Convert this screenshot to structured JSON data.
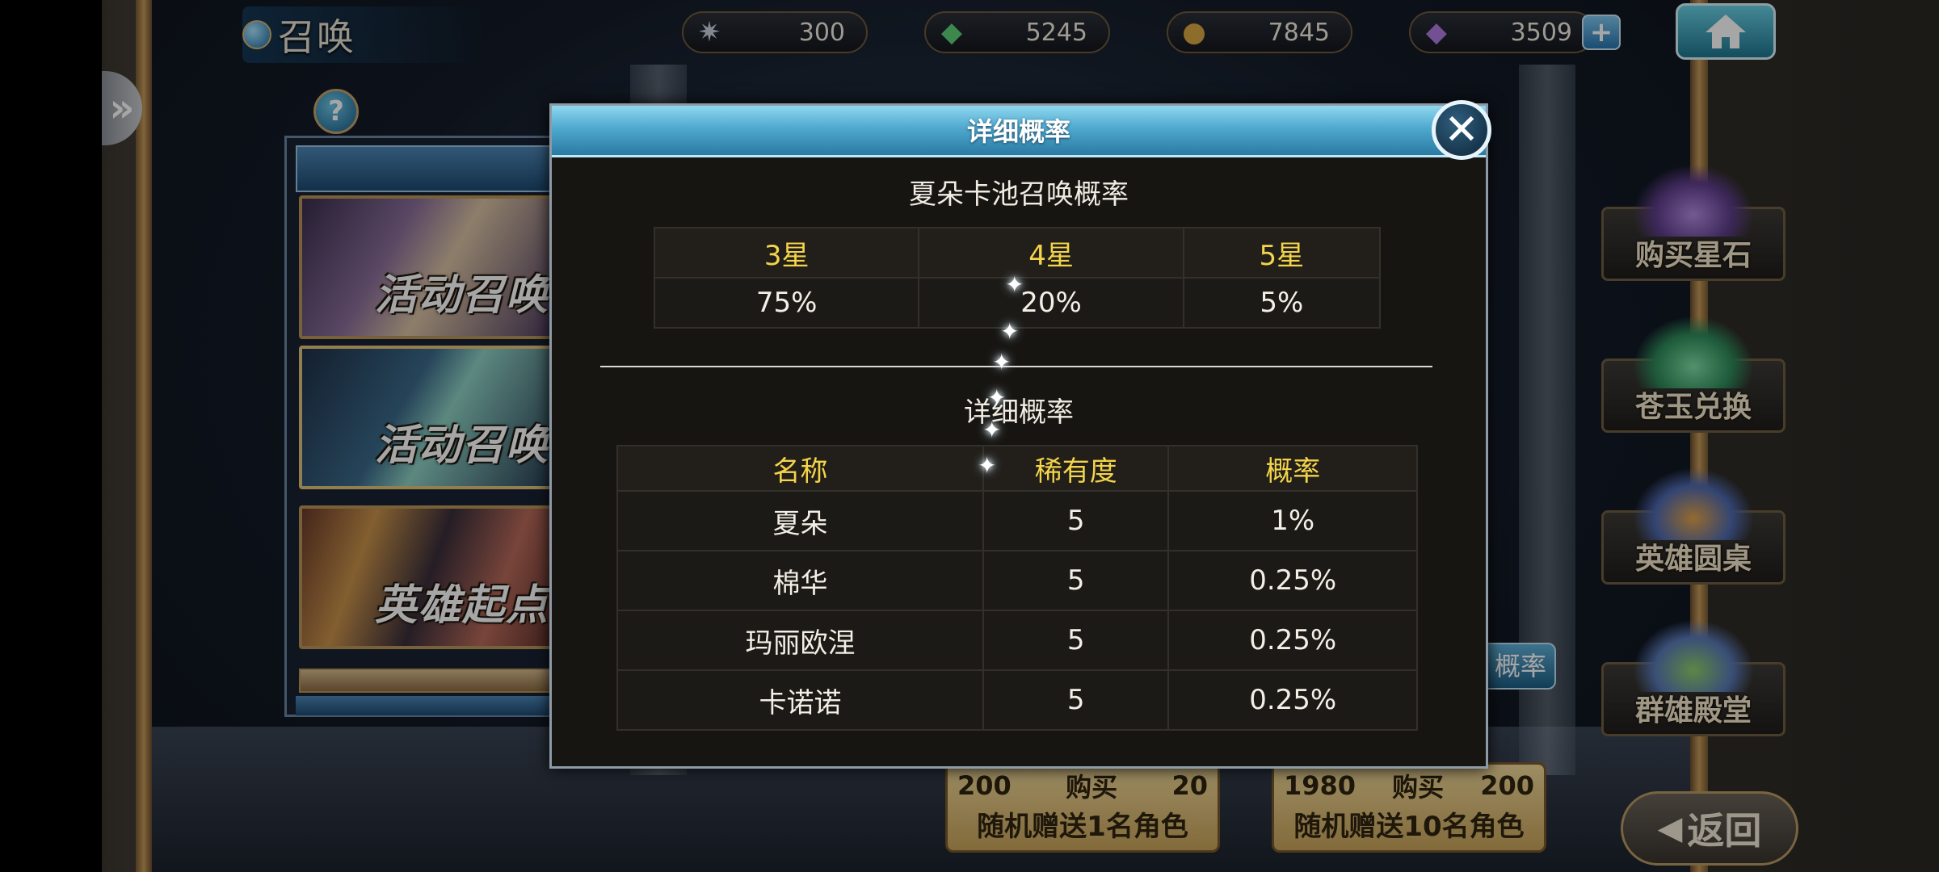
{
  "header": {
    "title": "召唤",
    "currencies": [
      {
        "icon": "star-shard-icon",
        "value": "300"
      },
      {
        "icon": "green-crystal-icon",
        "value": "5245"
      },
      {
        "icon": "gold-coin-icon",
        "value": "7845"
      },
      {
        "icon": "rainbow-gem-icon",
        "value": "3509"
      }
    ],
    "plus_label": "+"
  },
  "banners": [
    {
      "label": "活动召唤"
    },
    {
      "label": "活动召唤"
    },
    {
      "label": "英雄起点"
    }
  ],
  "help_label": "?",
  "side_menu": [
    {
      "label": "购买星石"
    },
    {
      "label": "苍玉兑换"
    },
    {
      "label": "英雄圆桌"
    },
    {
      "label": "群雄殿堂"
    }
  ],
  "behind_button_label": "概率",
  "purchase": [
    {
      "price_gem": "200",
      "buy_label": "购买",
      "price_coin": "20",
      "gift": "随机赠送1名角色"
    },
    {
      "price_gem": "1980",
      "buy_label": "购买",
      "price_coin": "200",
      "gift": "随机赠送10名角色"
    }
  ],
  "back_label": "返回",
  "modal": {
    "title": "详细概率",
    "close_label": "✕",
    "pool_title": "夏朵卡池召唤概率",
    "star_rates": {
      "headers": [
        "3星",
        "4星",
        "5星"
      ],
      "values": [
        "75%",
        "20%",
        "5%"
      ]
    },
    "detail_title": "详细概率",
    "detail_table": {
      "headers": [
        "名称",
        "稀有度",
        "概率"
      ],
      "rows": [
        [
          "夏朵",
          "5",
          "1%"
        ],
        [
          "棉华",
          "5",
          "0.25%"
        ],
        [
          "玛丽欧涅",
          "5",
          "0.25%"
        ],
        [
          "卡诺诺",
          "5",
          "0.25%"
        ]
      ]
    }
  },
  "colors": {
    "header_gold": "#f3d44a",
    "modal_bg": "#171512",
    "title_bar": "#4fa9cf"
  }
}
